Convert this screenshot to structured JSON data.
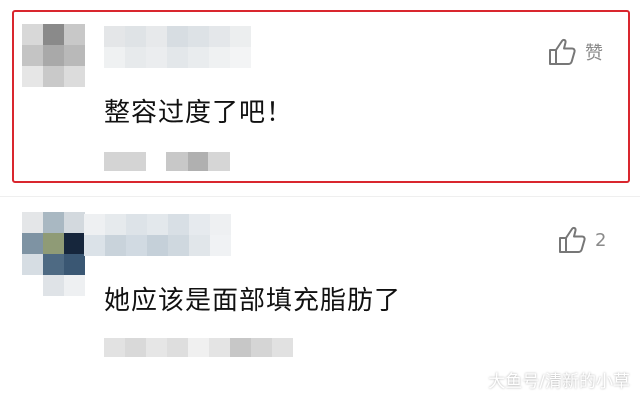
{
  "comments": [
    {
      "text": "整容过度了吧！",
      "like_label": "赞",
      "highlighted": true
    },
    {
      "text": "她应该是面部填充脂肪了",
      "like_count": "2",
      "highlighted": false
    }
  ],
  "watermark": "大鱼号/清新的小草",
  "colors": {
    "highlight_border": "#d9262e",
    "text": "#111111",
    "like_icon": "#777777"
  }
}
